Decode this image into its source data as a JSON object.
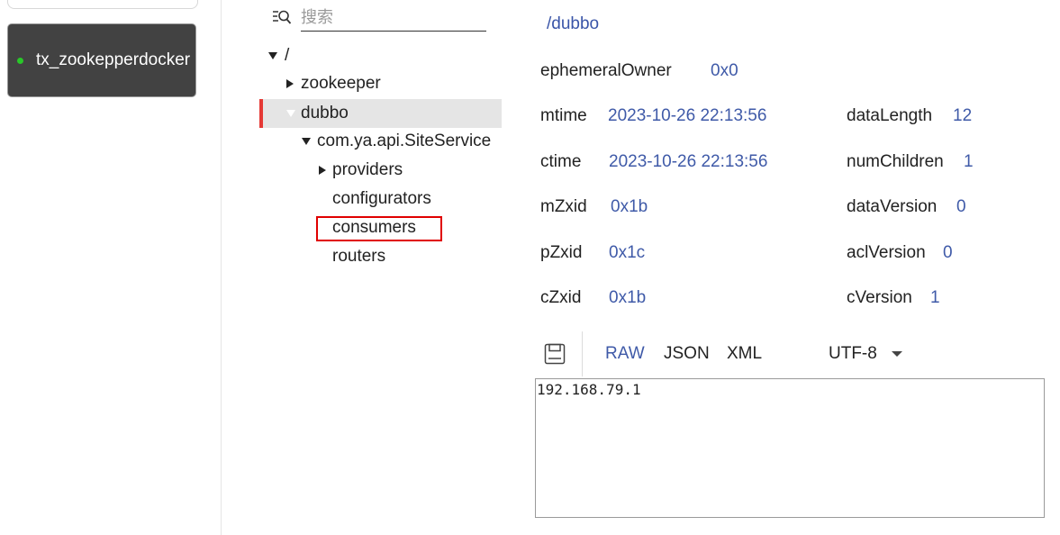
{
  "connection": {
    "name": "tx_zookepperdocker",
    "status_color": "#29c729"
  },
  "search": {
    "icon": "filter-search-icon",
    "placeholder": "搜索"
  },
  "tree": {
    "root": "/",
    "nodes": {
      "zookeeper": "zookeeper",
      "dubbo": "dubbo",
      "service": "com.ya.api.SiteService",
      "providers": "providers",
      "configurators": "configurators",
      "consumers": "consumers",
      "routers": "routers"
    },
    "selected": "dubbo",
    "selected_accent": "#e53935",
    "highlight_color": "#e00000"
  },
  "details": {
    "path": "/dubbo",
    "stats": {
      "ephemeralOwner": {
        "label": "ephemeralOwner",
        "value": "0x0"
      },
      "mtime": {
        "label": "mtime",
        "value": "2023-10-26 22:13:56"
      },
      "ctime": {
        "label": "ctime",
        "value": "2023-10-26 22:13:56"
      },
      "mZxid": {
        "label": "mZxid",
        "value": "0x1b"
      },
      "pZxid": {
        "label": "pZxid",
        "value": "0x1c"
      },
      "cZxid": {
        "label": "cZxid",
        "value": "0x1b"
      },
      "dataLength": {
        "label": "dataLength",
        "value": "12"
      },
      "numChildren": {
        "label": "numChildren",
        "value": "1"
      },
      "dataVersion": {
        "label": "dataVersion",
        "value": "0"
      },
      "aclVersion": {
        "label": "aclVersion",
        "value": "0"
      },
      "cVersion": {
        "label": "cVersion",
        "value": "1"
      }
    },
    "value_color": "#3f5aa8"
  },
  "toolbar": {
    "save_icon": "save-icon",
    "formats": {
      "raw": "RAW",
      "json": "JSON",
      "xml": "XML"
    },
    "active_format": "RAW",
    "encoding": "UTF-8"
  },
  "data_content": "192.168.79.1"
}
